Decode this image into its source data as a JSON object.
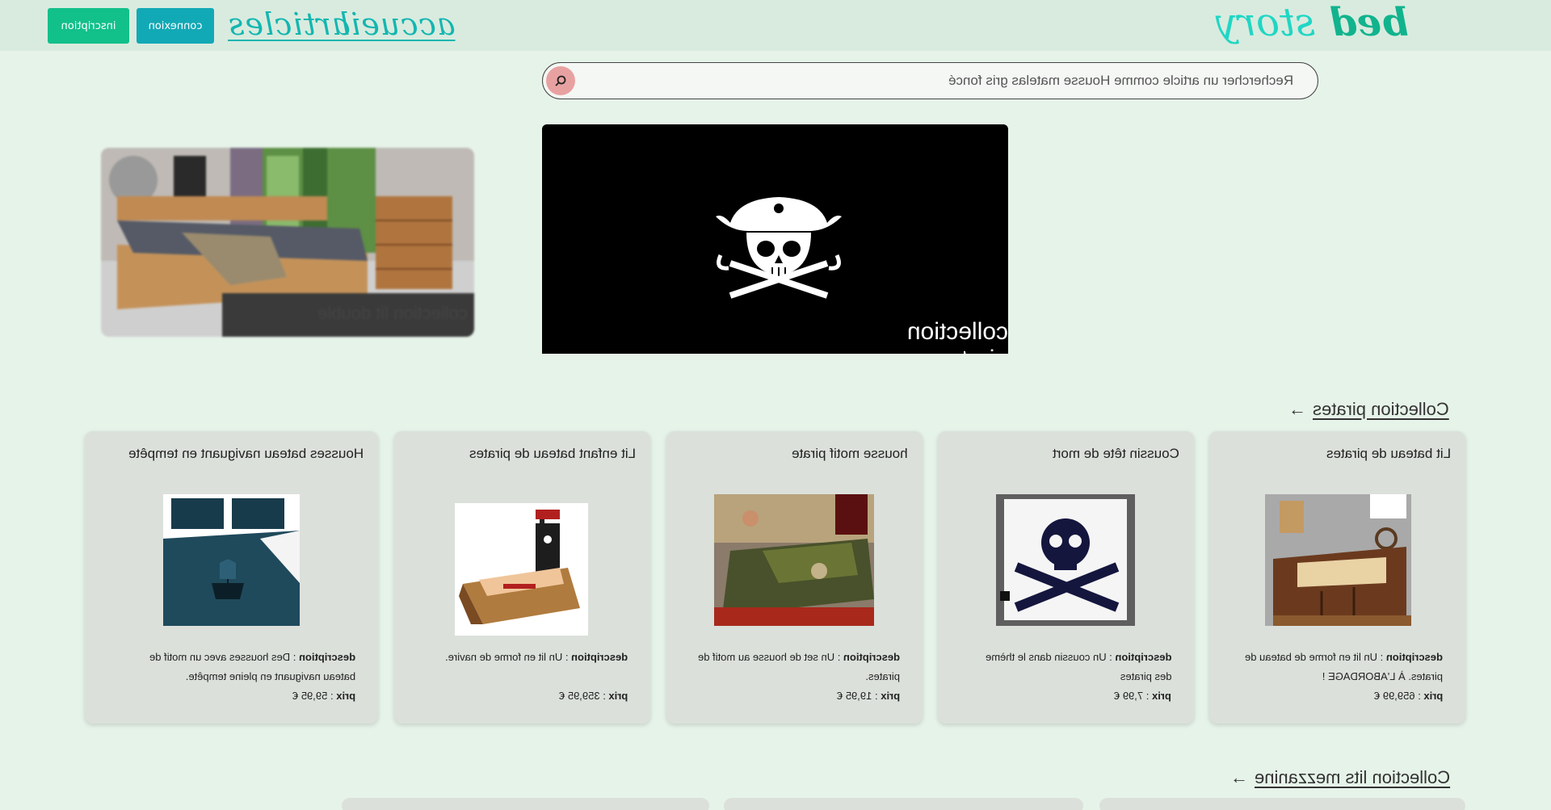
{
  "header": {
    "logo_word1": "bed",
    "logo_word2": "story",
    "nav_home": "accueil",
    "nav_articles": "articles",
    "login_label": "connexion",
    "signup_label": "inscription"
  },
  "search": {
    "placeholder": "Rechercher un article comme Housse matelas gris foncé"
  },
  "banners": [
    {
      "caption": "collection lit double"
    },
    {
      "caption": "collection pirates"
    }
  ],
  "sections": [
    {
      "title": "Collection pirates",
      "arrow": "→"
    },
    {
      "title": "Collection lits mezzanine",
      "arrow": "→"
    }
  ],
  "products": [
    {
      "title": "Lit bateau de pirates",
      "desc_label": "description",
      "desc_line1": " : Un lit en forme de bateau de",
      "desc_line2": "pirates. À L'ABORDAGE !",
      "price_label": "prix",
      "price": " : 659,99 €"
    },
    {
      "title": "Coussin tête de mort",
      "desc_label": "description",
      "desc_line1": " : Un coussin dans le thème",
      "desc_line2": "des pirates",
      "price_label": "prix",
      "price": " : 7,99 €"
    },
    {
      "title": "housse motif pirate",
      "desc_label": "description",
      "desc_line1": " : Un set de housse au motif de",
      "desc_line2": "pirates.",
      "price_label": "prix",
      "price": " : 19,95 €"
    },
    {
      "title": "Lit enfant bateau de pirates",
      "desc_label": "description",
      "desc_line1": " : Un lit en forme de navire.",
      "desc_line2": "",
      "price_label": "prix",
      "price": " : 359,95 €"
    },
    {
      "title": "Housses bateau naviguant en tempête",
      "desc_label": "description",
      "desc_line1": " : Des housses avec un motif de",
      "desc_line2": "bateau naviguant en pleine tempête.",
      "price_label": "prix",
      "price": " : 59,95 €"
    }
  ],
  "colors": {
    "background": "#e6f3e9",
    "header": "#d9ebdf",
    "signup": "#12c08a",
    "login": "#12a9b6",
    "nav": "#13b6b0",
    "card": "#dbe0db"
  }
}
